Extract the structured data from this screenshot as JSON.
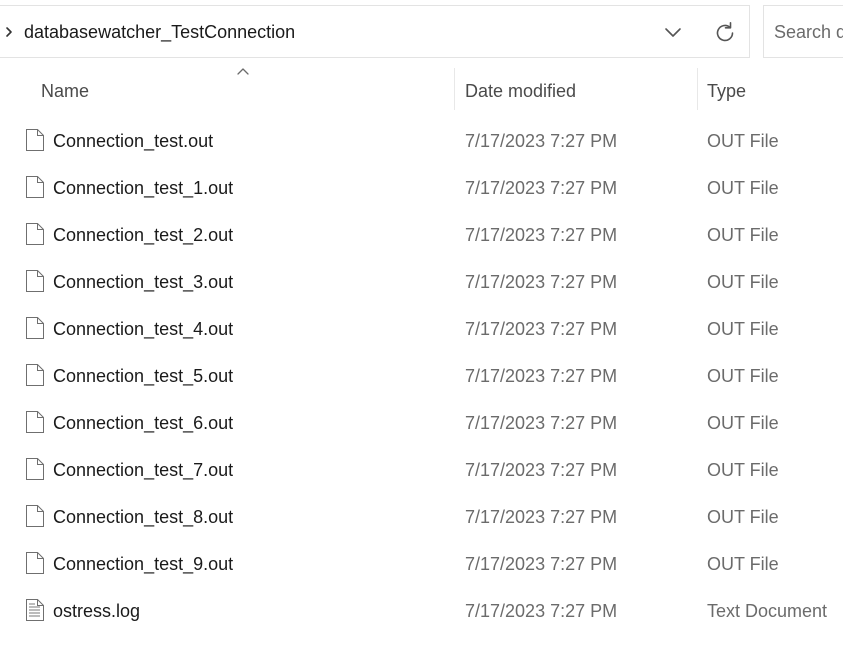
{
  "address_bar": {
    "path": "databasewatcher_TestConnection"
  },
  "search": {
    "placeholder": "Search databasewatcher_TestConnection"
  },
  "columns": {
    "name": "Name",
    "date_modified": "Date modified",
    "type": "Type"
  },
  "icons": {
    "nav": "chevron-right-icon",
    "history": "chevron-down-icon",
    "refresh": "refresh-icon",
    "sort": "sort-ascending-icon",
    "file": "file-icon",
    "text_file": "text-document-icon"
  },
  "files": [
    {
      "name": "Connection_test.out",
      "date": "7/17/2023 7:27 PM",
      "type": "OUT File",
      "icon": "file-icon"
    },
    {
      "name": "Connection_test_1.out",
      "date": "7/17/2023 7:27 PM",
      "type": "OUT File",
      "icon": "file-icon"
    },
    {
      "name": "Connection_test_2.out",
      "date": "7/17/2023 7:27 PM",
      "type": "OUT File",
      "icon": "file-icon"
    },
    {
      "name": "Connection_test_3.out",
      "date": "7/17/2023 7:27 PM",
      "type": "OUT File",
      "icon": "file-icon"
    },
    {
      "name": "Connection_test_4.out",
      "date": "7/17/2023 7:27 PM",
      "type": "OUT File",
      "icon": "file-icon"
    },
    {
      "name": "Connection_test_5.out",
      "date": "7/17/2023 7:27 PM",
      "type": "OUT File",
      "icon": "file-icon"
    },
    {
      "name": "Connection_test_6.out",
      "date": "7/17/2023 7:27 PM",
      "type": "OUT File",
      "icon": "file-icon"
    },
    {
      "name": "Connection_test_7.out",
      "date": "7/17/2023 7:27 PM",
      "type": "OUT File",
      "icon": "file-icon"
    },
    {
      "name": "Connection_test_8.out",
      "date": "7/17/2023 7:27 PM",
      "type": "OUT File",
      "icon": "file-icon"
    },
    {
      "name": "Connection_test_9.out",
      "date": "7/17/2023 7:27 PM",
      "type": "OUT File",
      "icon": "file-icon"
    },
    {
      "name": "ostress.log",
      "date": "7/17/2023 7:27 PM",
      "type": "Text Document",
      "icon": "text-document-icon"
    }
  ]
}
